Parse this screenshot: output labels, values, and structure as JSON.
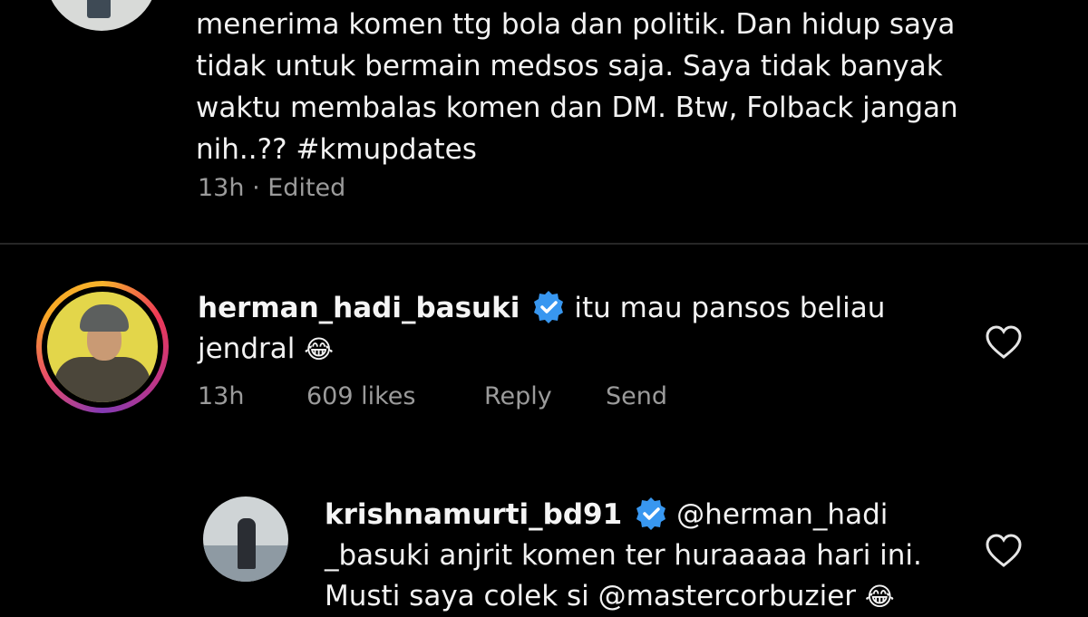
{
  "post": {
    "caption_lines": [
      "menerima komen ttg bola dan politik. Dan hidup saya",
      "tidak untuk bermain medsos saja. Saya tidak banyak",
      "waktu membalas komen dan DM. Btw, Folback jangan",
      "nih..?? #kmupdates"
    ],
    "time": "13h",
    "separator": "·",
    "edited_label": "Edited"
  },
  "comments": [
    {
      "username": "herman_hadi_basuki",
      "text_line1": "itu mau pansos beliau",
      "text_line2": "jendral",
      "emoji": "😂",
      "time": "13h",
      "likes": "609 likes",
      "reply_label": "Reply",
      "send_label": "Send",
      "like_icon": "heart-outline-icon"
    },
    {
      "username": "krishnamurti_bd91",
      "text_line1": "@herman_hadi",
      "text_line2": "_basuki anjrit komen ter huraaaaa hari ini.",
      "text_line3": "Musti saya colek si @mastercorbuzier",
      "emoji": "😂",
      "like_icon": "heart-outline-icon"
    }
  ],
  "colors": {
    "background": "#000000",
    "text": "#f2f2f2",
    "meta": "#9b9b9b",
    "verified": "#3897f0"
  }
}
